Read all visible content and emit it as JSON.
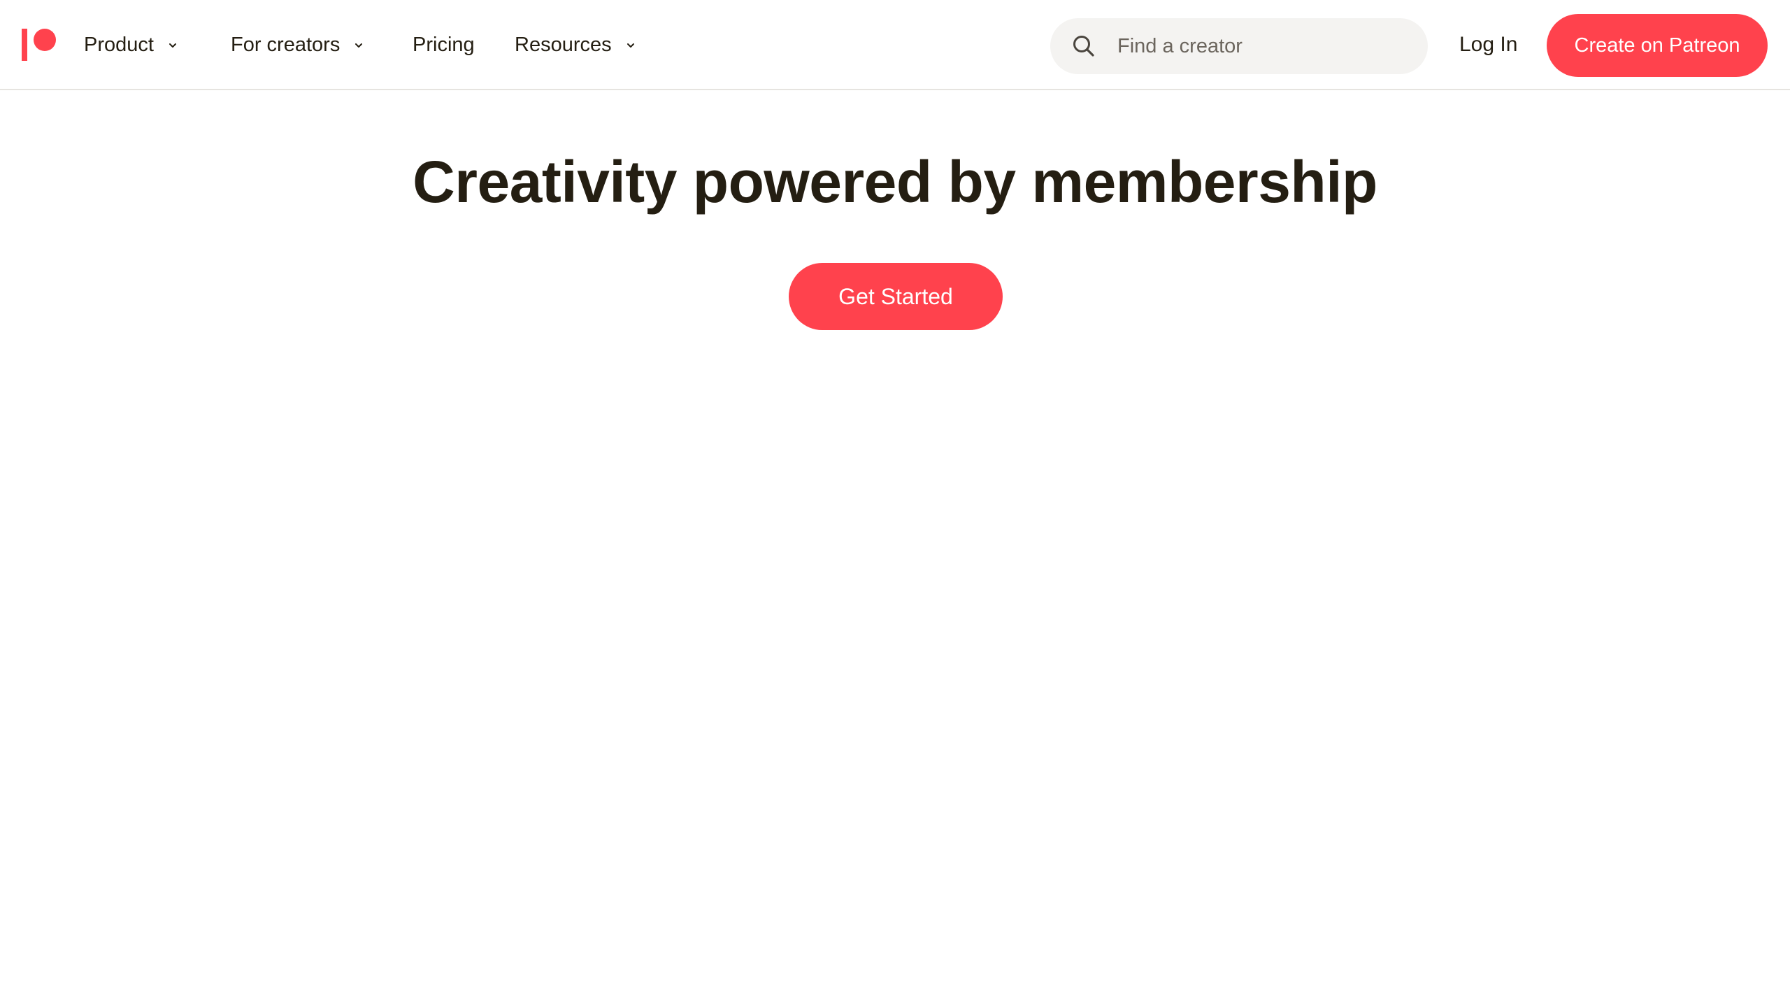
{
  "header": {
    "logo_icon": "patreon-logo-icon",
    "nav": [
      {
        "label": "Product",
        "has_dropdown": true
      },
      {
        "label": "For creators",
        "has_dropdown": true
      },
      {
        "label": "Pricing",
        "has_dropdown": false
      },
      {
        "label": "Resources",
        "has_dropdown": true
      }
    ],
    "search": {
      "placeholder": "Find a creator",
      "value": "",
      "icon": "search-icon"
    },
    "login_label": "Log In",
    "create_label": "Create on Patreon"
  },
  "hero": {
    "title": "Creativity powered by membership",
    "cta_label": "Get Started"
  },
  "colors": {
    "brand": "#ff424d",
    "text": "#241e12",
    "search_bg": "#f4f3f1",
    "divider": "#e6e4e0"
  }
}
